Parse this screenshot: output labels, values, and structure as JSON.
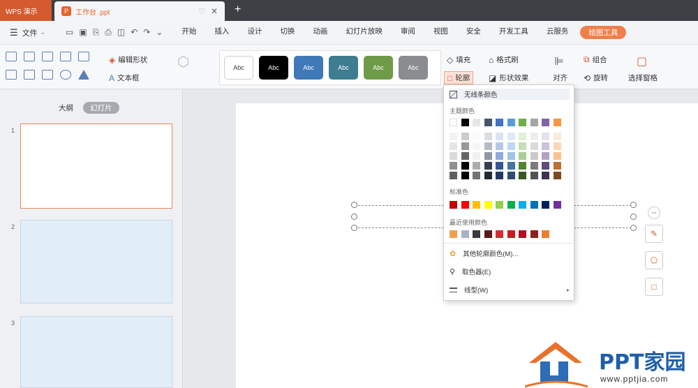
{
  "titlebar": {
    "app_tab": "WPS 演示",
    "doc_name": "工作台 .ppt",
    "add_tab": "+"
  },
  "menubar": {
    "file": "文件",
    "tabs": [
      "开始",
      "插入",
      "设计",
      "切换",
      "动画",
      "幻灯片放映",
      "审阅",
      "视图",
      "安全",
      "开发工具",
      "云服务"
    ],
    "active_tool": "绘图工具"
  },
  "ribbon": {
    "edit_shape": "编辑形状",
    "textbox": "文本框",
    "fill": "填充",
    "format_painter": "格式刷",
    "outline": "轮廓",
    "shape_effect": "形状效果",
    "align": "对齐",
    "combine": "组合",
    "rotate": "旋转",
    "select_pane": "选择窗格",
    "style_label": "Abc",
    "style_colors": [
      "#ffffff",
      "#000000",
      "#3f79b8",
      "#3e7d90",
      "#6f9a48",
      "#8a8c8f"
    ]
  },
  "left_panel": {
    "tab_outline": "大纲",
    "tab_slides": "幻灯片",
    "thumb_numbers": [
      "1",
      "2",
      "3"
    ]
  },
  "dropdown": {
    "no_outline": "无线条颜色",
    "theme_colors_label": "主题颜色",
    "standard_colors_label": "标准色",
    "recent_colors_label": "最近使用颜色",
    "more_colors": "其他轮廓颜色(M)...",
    "eyedropper": "取色器(E)",
    "line_style": "线型(W)",
    "theme_top": [
      "#ffffff",
      "#000000",
      "#e7e6e6",
      "#44546a",
      "#4472c4",
      "#5b9bd5",
      "#70ad47",
      "#a5a5a5",
      "#8064a2",
      "#f79646"
    ],
    "standard": [
      "#c00000",
      "#ff0000",
      "#ffc000",
      "#ffff00",
      "#92d050",
      "#00b050",
      "#00b0f0",
      "#0070c0",
      "#002060",
      "#7030a0"
    ],
    "recent": [
      "#f0a050",
      "#a6b4c6",
      "#3a3a3a",
      "#5a1a1a",
      "#d03030",
      "#c02020",
      "#b01020",
      "#902020",
      "#ed7d31"
    ]
  },
  "watermark": {
    "brand": "PPT家园",
    "url": "www.pptjia.com"
  }
}
